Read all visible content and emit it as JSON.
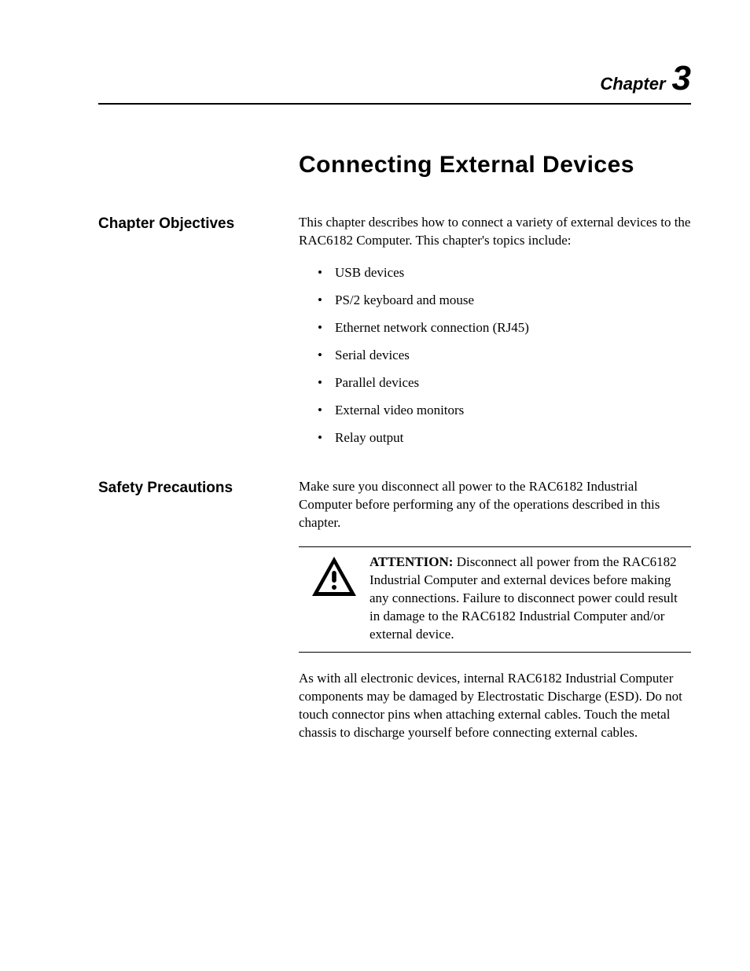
{
  "header": {
    "chapter_label": "Chapter",
    "chapter_number": "3"
  },
  "title": "Connecting External Devices",
  "sections": {
    "objectives": {
      "heading": "Chapter Objectives",
      "intro": "This chapter describes how to connect a variety of external devices to the RAC6182 Computer.  This chapter's topics include:",
      "bullets": [
        "USB devices",
        "PS/2 keyboard and mouse",
        "Ethernet network connection (RJ45)",
        "Serial devices",
        "Parallel devices",
        "External video monitors",
        "Relay output"
      ]
    },
    "safety": {
      "heading": "Safety Precautions",
      "intro": "Make sure you disconnect all power to the RAC6182 Industrial Computer before performing any of the operations described in this chapter.",
      "attention_label": "ATTENTION:",
      "attention_body": " Disconnect all power from the RAC6182 Industrial Computer and external devices before making any connections.  Failure to disconnect power could result in damage to the RAC6182 Industrial Computer and/or external device.",
      "esd": "As with all electronic devices, internal RAC6182 Industrial Computer components may be damaged by Electrostatic Discharge (ESD).  Do not touch connector pins when attaching external cables.  Touch the metal chassis to discharge yourself before connecting external cables."
    }
  }
}
